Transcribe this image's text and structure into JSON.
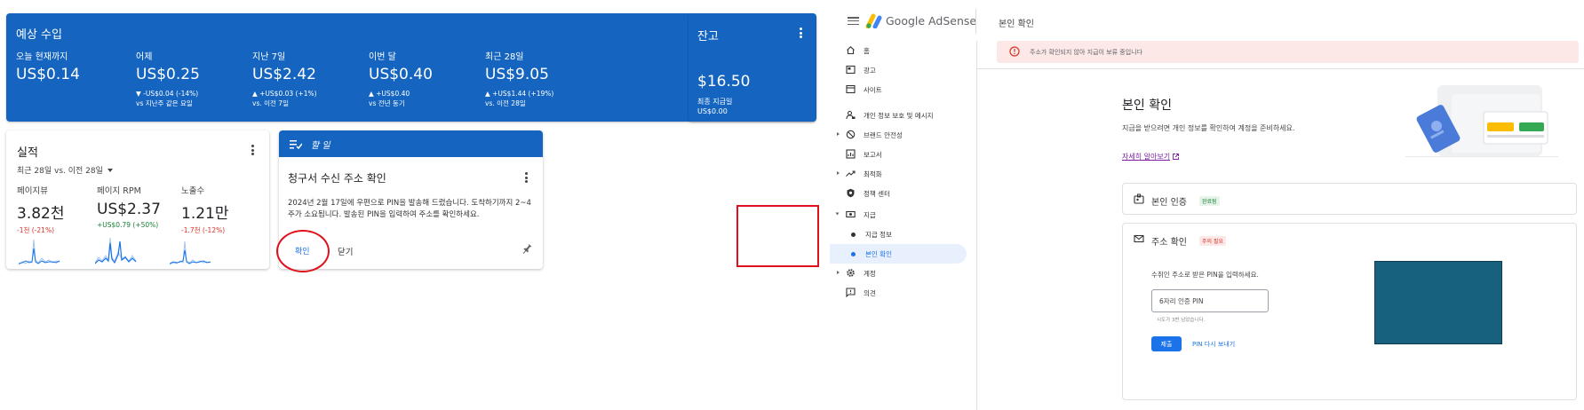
{
  "colors": {
    "primary_blue": "#1565c0",
    "accent_blue": "#1a73e8",
    "negative": "#d93025",
    "positive": "#188038",
    "highlight": "#e0101c",
    "redacted": "#17607e"
  },
  "estimated": {
    "title": "예상 수입",
    "stats": [
      {
        "label": "오늘 현재까지",
        "value": "US$0.14",
        "change": "",
        "compare": ""
      },
      {
        "label": "어제",
        "value": "US$0.25",
        "change": "▼ -US$0.04 (-14%)",
        "compare": "vs 지난주 같은 요일"
      },
      {
        "label": "지난 7일",
        "value": "US$2.42",
        "change": "▲ +US$0.03 (+1%)",
        "compare": "vs. 이전 7일"
      },
      {
        "label": "이번 달",
        "value": "US$0.40",
        "change": "▲ +US$0.40",
        "compare": "vs 전년 동기"
      },
      {
        "label": "최근 28일",
        "value": "US$9.05",
        "change": "▲ +US$1.44 (+19%)",
        "compare": "vs. 이전 28일"
      }
    ]
  },
  "balance": {
    "title": "잔고",
    "value": "$16.50",
    "last_payment_label": "최종 지급일",
    "last_payment_value": "US$0.00"
  },
  "performance": {
    "title": "실적",
    "range": "최근 28일 vs. 이전 28일",
    "metrics": [
      {
        "label": "페이지뷰",
        "value": "3.82천",
        "change": "-1천 (-21%)",
        "trend": "negative"
      },
      {
        "label": "페이지 RPM",
        "value": "US$2.37",
        "change": "+US$0.79 (+50%)",
        "trend": "positive"
      },
      {
        "label": "노출수",
        "value": "1.21만",
        "change": "-1.7천 (-12%)",
        "trend": "negative"
      }
    ]
  },
  "todo": {
    "header": "할 일",
    "title": "청구서 수신 주소 확인",
    "body": "2024년 2월 17일에 우편으로 PIN을 발송해 드렸습니다. 도착하기까지 2~4주가 소요됩니다. 발송된 PIN을 입력하여 주소를 확인하세요.",
    "confirm_label": "확인",
    "close_label": "닫기"
  },
  "app": {
    "name": "Google AdSense",
    "page_title": "본인 확인"
  },
  "sidebar": {
    "items": [
      {
        "label": "홈",
        "icon": "home-icon"
      },
      {
        "label": "광고",
        "icon": "ads-icon"
      },
      {
        "label": "사이트",
        "icon": "sites-icon"
      },
      {
        "label": "개인 정보 보호 및 메시지",
        "icon": "privacy-icon"
      },
      {
        "label": "브랜드 안전성",
        "icon": "block-icon"
      },
      {
        "label": "보고서",
        "icon": "reports-icon"
      },
      {
        "label": "최적화",
        "icon": "trending-icon"
      },
      {
        "label": "정책 센터",
        "icon": "policy-icon"
      },
      {
        "label": "지급",
        "icon": "payments-icon"
      },
      {
        "label": "지급 정보",
        "icon": ""
      },
      {
        "label": "본인 확인",
        "icon": ""
      },
      {
        "label": "계정",
        "icon": "gear-icon"
      },
      {
        "label": "의견",
        "icon": "feedback-icon"
      }
    ]
  },
  "alert": {
    "text": "주소가 확인되지 않아 지급이 보류 중입니다"
  },
  "verify": {
    "title": "본인 확인",
    "description": "지급을 받으려면 개인 정보를 확인하여 계정을 준비하세요.",
    "learn_more": "자세히 알아보기",
    "identity": {
      "label": "본인 인증",
      "badge": "완료됨"
    },
    "address": {
      "label": "주소 확인",
      "badge": "주의 필요",
      "instruction": "수취인 주소로 받은 PIN을 입력하세요.",
      "pin_placeholder": "6자리 인증 PIN",
      "attempts": "시도가 3번 남았습니다.",
      "submit_label": "제출",
      "resend_label": "PIN 다시 보내기"
    }
  }
}
